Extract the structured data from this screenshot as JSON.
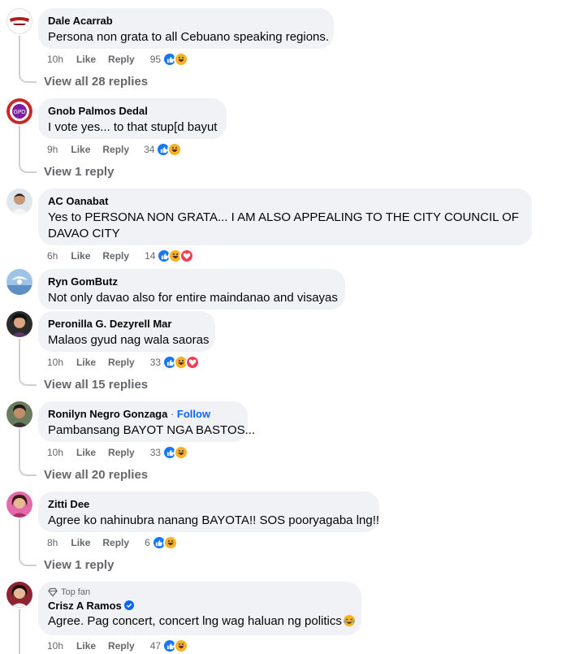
{
  "comments": [
    {
      "author": "Dale Acarrab",
      "text": "Persona non grata to all Cebuano speaking regions.",
      "time": "10h",
      "like": "Like",
      "reply": "Reply",
      "count": "95",
      "view_replies": "View all 28 replies"
    },
    {
      "author": "Gnob Palmos Dedal",
      "text": "I vote yes... to that stup[d bayut",
      "time": "9h",
      "like": "Like",
      "reply": "Reply",
      "count": "34",
      "view_replies": "View 1 reply"
    },
    {
      "author": "AC Oanabat",
      "text_line1": "Yes to PERSONA NON GRATA... I AM ALSO APPEALING TO THE CITY COUNCIL OF",
      "text_line2": "DAVAO CITY",
      "time": "6h",
      "like": "Like",
      "reply": "Reply",
      "count": "14"
    },
    {
      "author": "Ryn GomButz",
      "text": "Not only davao also for entire maindanao and visayas"
    },
    {
      "author": "Peronilla G. Dezyrell Mar",
      "text": "Malaos gyud nag wala saoras",
      "time": "10h",
      "like": "Like",
      "reply": "Reply",
      "count": "33",
      "view_replies": "View all 15 replies"
    },
    {
      "author": "Ronilyn Negro Gonzaga",
      "follow": "Follow",
      "text": "Pambansang BAYOT NGA BASTOS...",
      "time": "10h",
      "like": "Like",
      "reply": "Reply",
      "count": "33",
      "view_replies": "View all 20 replies"
    },
    {
      "author": "Zitti Dee",
      "text": "Agree ko nahinubra nanang BAYOTA!! SOS pooryagaba lng!!",
      "time": "8h",
      "like": "Like",
      "reply": "Reply",
      "count": "6",
      "view_replies": "View 1 reply"
    },
    {
      "badge": "Top fan",
      "author": "Crisz A Ramos",
      "text": "Agree. Pag concert, concert lng wag haluan ng politics",
      "time": "10h",
      "like": "Like",
      "reply": "Reply",
      "count": "47"
    }
  ],
  "colors": {
    "like": "#1877f2",
    "haha": "#f7b125",
    "love": "#f33e58",
    "follow": "#0866ff",
    "bubble": "#f0f2f5"
  }
}
